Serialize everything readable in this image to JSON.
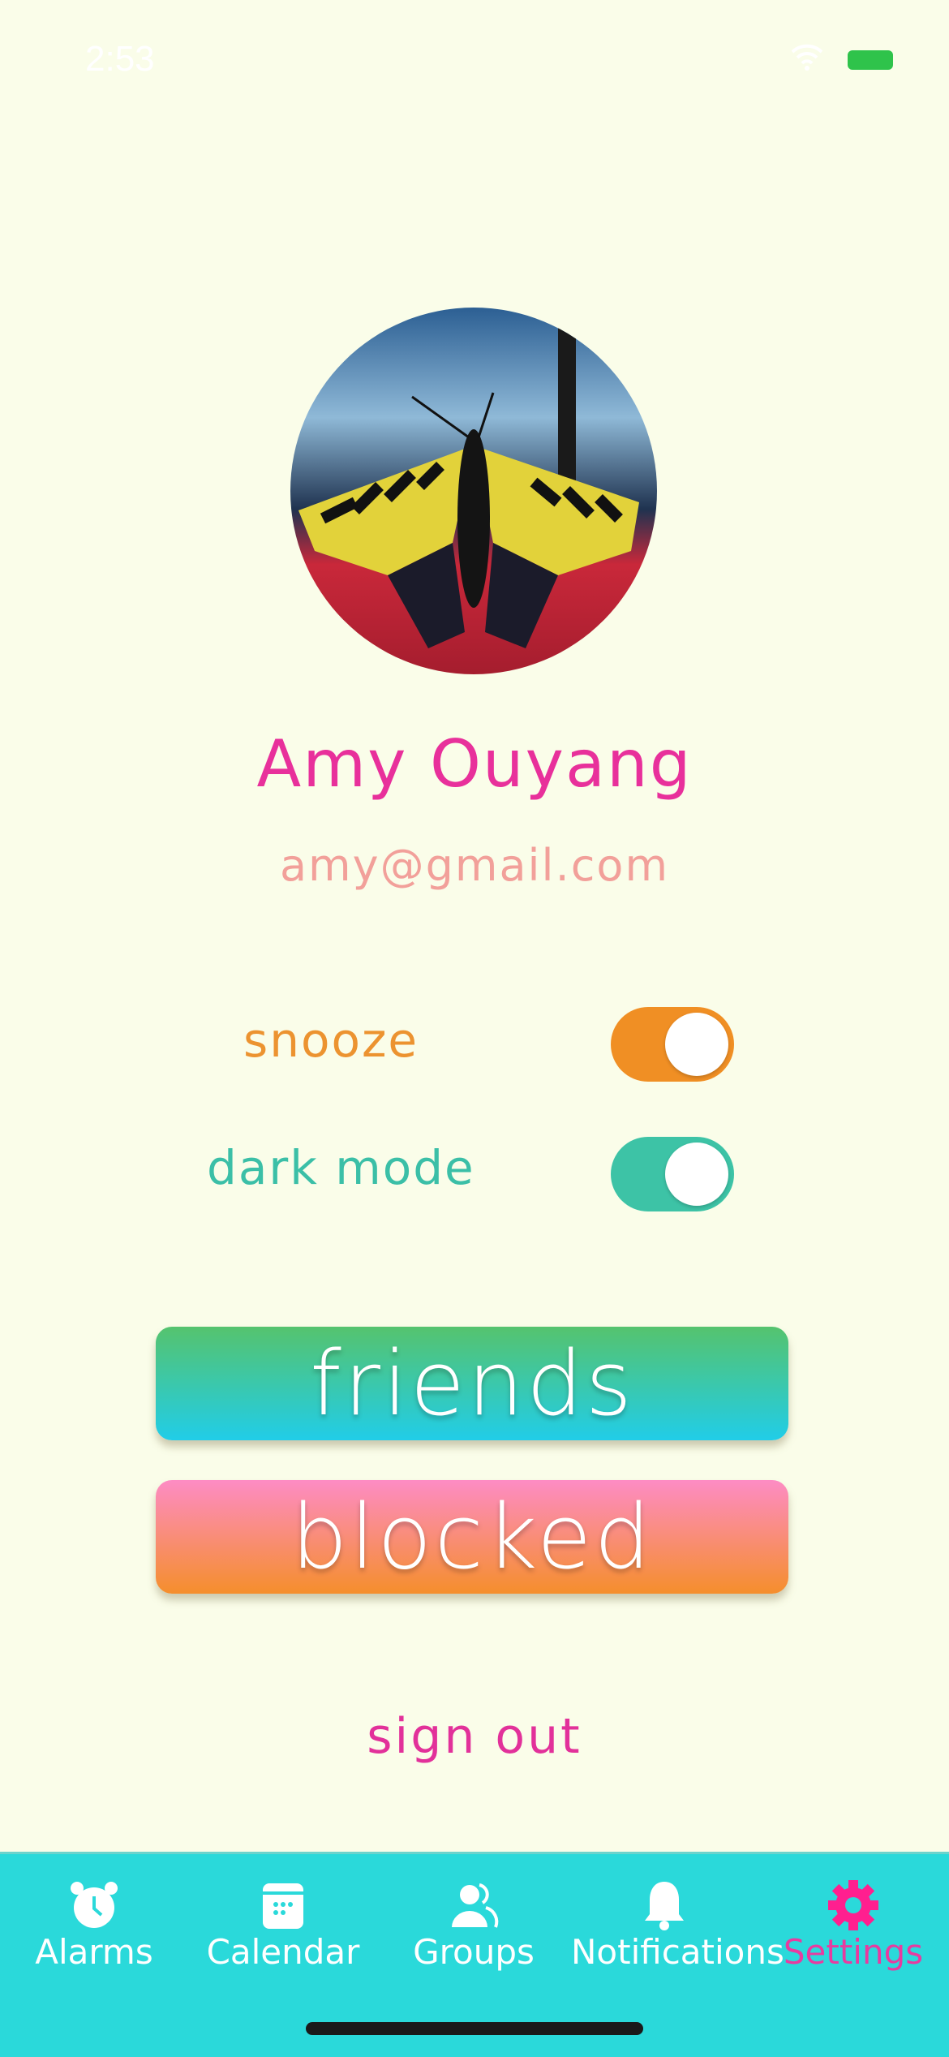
{
  "status_bar": {
    "time": "2:53",
    "battery_color": "#2fc34b"
  },
  "profile": {
    "name": "Amy Ouyang",
    "email": "amy@gmail.com",
    "avatar": "butterfly-photo"
  },
  "settings": {
    "snooze": {
      "label": "snooze",
      "on": true,
      "color": "#f08f24"
    },
    "dark_mode": {
      "label": "dark mode",
      "on": true,
      "color": "#3dc3a6"
    }
  },
  "buttons": {
    "friends": "friends",
    "blocked": "blocked",
    "sign_out": "sign out"
  },
  "tabbar": {
    "background": "#2ad9da",
    "active_color": "#ff1f8f",
    "items": [
      {
        "label": "Alarms",
        "icon": "alarm-clock-icon"
      },
      {
        "label": "Calendar",
        "icon": "calendar-icon"
      },
      {
        "label": "Groups",
        "icon": "groups-icon"
      },
      {
        "label": "Notifications",
        "icon": "bell-icon"
      },
      {
        "label": "Settings",
        "icon": "gear-icon",
        "active": true
      }
    ]
  }
}
